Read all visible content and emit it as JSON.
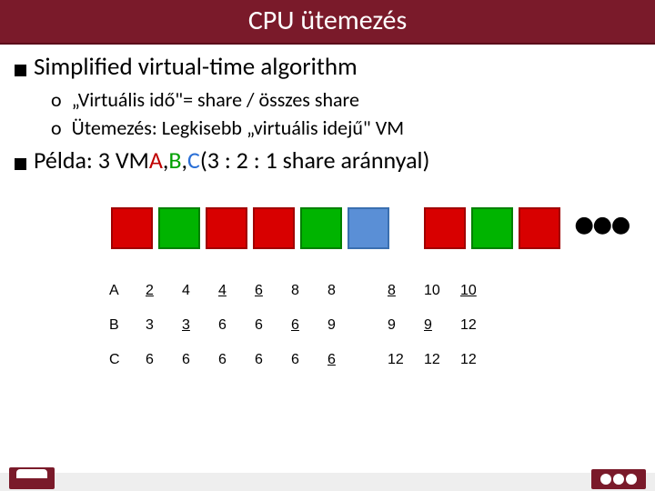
{
  "title": "CPU ütemezés",
  "heading": "Simplified virtual-time algorithm",
  "sub1": "„Virtuális idő\"= share / összes share",
  "sub2": "Ütemezés: Legkisebb „virtuális idejű\" VM",
  "pelda_label": "Példa:",
  "pelda_rest_1": "3 VM ",
  "pelda_A": "A",
  "pelda_sep": ", ",
  "pelda_B": "B",
  "pelda_C": "C",
  "pelda_rest_2": "  (3 : 2 : 1 share aránnyal)",
  "circ": "o",
  "dots": "●●●",
  "blocks": [
    "red",
    "green",
    "red",
    "red",
    "green",
    "blue",
    "gap",
    "red",
    "green",
    "red"
  ],
  "table": {
    "rows": [
      {
        "label": "A",
        "cells": [
          {
            "v": "2",
            "u": true
          },
          {
            "v": "4",
            "u": false
          },
          {
            "v": "4",
            "u": true
          },
          {
            "v": "6",
            "u": true
          },
          {
            "v": "8",
            "u": false
          },
          {
            "v": "8",
            "u": false
          },
          {
            "v": "gap"
          },
          {
            "v": "8",
            "u": true
          },
          {
            "v": "10",
            "u": false
          },
          {
            "v": "10",
            "u": true
          }
        ]
      },
      {
        "label": "B",
        "cells": [
          {
            "v": "3",
            "u": false
          },
          {
            "v": "3",
            "u": true
          },
          {
            "v": "6",
            "u": false
          },
          {
            "v": "6",
            "u": false
          },
          {
            "v": "6",
            "u": true
          },
          {
            "v": "9",
            "u": false
          },
          {
            "v": "gap"
          },
          {
            "v": "9",
            "u": false
          },
          {
            "v": "9",
            "u": true
          },
          {
            "v": "12",
            "u": false
          }
        ]
      },
      {
        "label": "C",
        "cells": [
          {
            "v": "6",
            "u": false
          },
          {
            "v": "6",
            "u": false
          },
          {
            "v": "6",
            "u": false
          },
          {
            "v": "6",
            "u": false
          },
          {
            "v": "6",
            "u": false
          },
          {
            "v": "6",
            "u": true
          },
          {
            "v": "gap"
          },
          {
            "v": "12",
            "u": false
          },
          {
            "v": "12",
            "u": false
          },
          {
            "v": "12",
            "u": false
          }
        ]
      }
    ]
  }
}
